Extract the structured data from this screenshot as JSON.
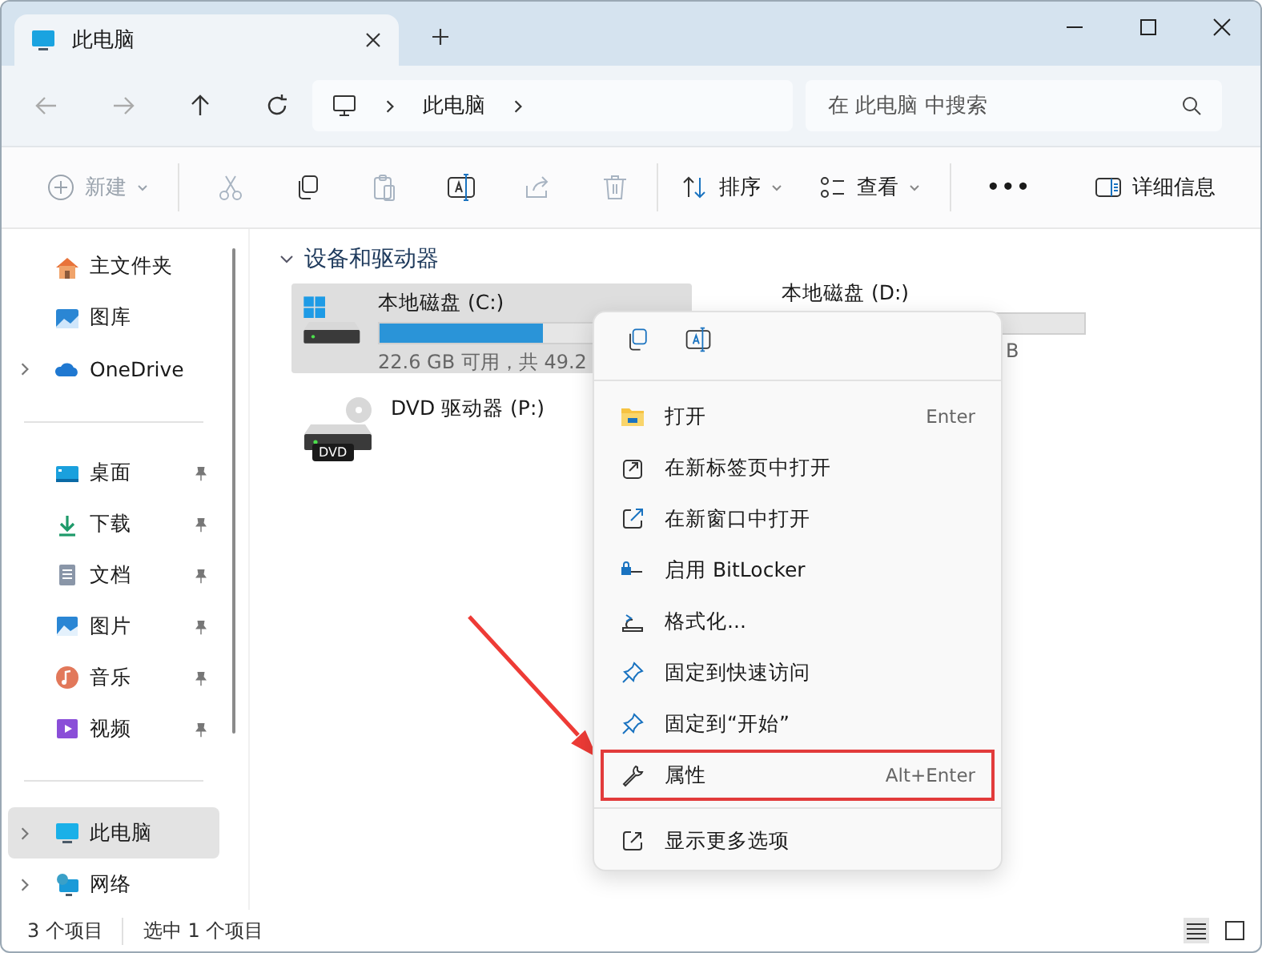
{
  "tab": {
    "title": "此电脑"
  },
  "nav": {
    "breadcrumb": "此电脑",
    "search": {
      "placeholder": "在 此电脑 中搜索"
    }
  },
  "toolbar": {
    "new": {
      "label": "新建",
      "disabled": true
    },
    "actions": [
      {
        "kind": "cut",
        "disabled": true
      },
      {
        "kind": "copy",
        "disabled": false
      },
      {
        "kind": "paste",
        "disabled": true
      },
      {
        "kind": "rename",
        "disabled": false
      },
      {
        "kind": "share",
        "disabled": true
      },
      {
        "kind": "delete",
        "disabled": true
      }
    ],
    "sort": "排序",
    "view": "查看",
    "more": "•••",
    "details": "详细信息"
  },
  "sidebar": {
    "groups": [
      [
        {
          "label": "主文件夹",
          "expandable": false,
          "pinned": false,
          "selected": false
        },
        {
          "label": "图库",
          "expandable": false,
          "pinned": false,
          "selected": false
        },
        {
          "label": "OneDrive",
          "expandable": true,
          "pinned": false,
          "selected": false
        }
      ],
      [
        {
          "label": "桌面",
          "expandable": false,
          "pinned": true,
          "selected": false
        },
        {
          "label": "下载",
          "expandable": false,
          "pinned": true,
          "selected": false
        },
        {
          "label": "文档",
          "expandable": false,
          "pinned": true,
          "selected": false
        },
        {
          "label": "图片",
          "expandable": false,
          "pinned": true,
          "selected": false
        },
        {
          "label": "音乐",
          "expandable": false,
          "pinned": true,
          "selected": false
        },
        {
          "label": "视频",
          "expandable": false,
          "pinned": true,
          "selected": false
        }
      ],
      [
        {
          "label": "此电脑",
          "expandable": true,
          "pinned": false,
          "selected": true
        },
        {
          "label": "网络",
          "expandable": true,
          "pinned": false,
          "selected": false
        }
      ]
    ]
  },
  "section": {
    "title": "设备和驱动器",
    "expanded": true
  },
  "drives": [
    {
      "kind": "disk",
      "name": "本地磁盘 (C:)",
      "level": 0.54,
      "info": "22.6 GB 可用，共 49.2",
      "selected": true
    },
    {
      "kind": "dvd",
      "name": "DVD 驱动器 (P:)",
      "badge": "DVD",
      "selected": false
    }
  ],
  "drive_d": {
    "name": "本地磁盘 (D:)",
    "info": "B"
  },
  "context_menu": {
    "items": [
      {
        "label": "打开",
        "shortcut": "Enter",
        "highlighted": false
      },
      {
        "label": "在新标签页中打开",
        "highlighted": false
      },
      {
        "label": "在新窗口中打开",
        "highlighted": false
      },
      {
        "label": "启用 BitLocker",
        "highlighted": false
      },
      {
        "label": "格式化...",
        "highlighted": false
      },
      {
        "label": "固定到快速访问",
        "highlighted": false
      },
      {
        "label": "固定到“开始”",
        "highlighted": false
      },
      {
        "label": "属性",
        "shortcut": "Alt+Enter",
        "highlighted": true
      }
    ],
    "more": {
      "label": "显示更多选项"
    }
  },
  "status_bar": {
    "count": "3 个项目",
    "selection": "选中 1 个项目",
    "view_buttons": [
      {
        "selected": true
      },
      {
        "selected": false
      }
    ]
  }
}
